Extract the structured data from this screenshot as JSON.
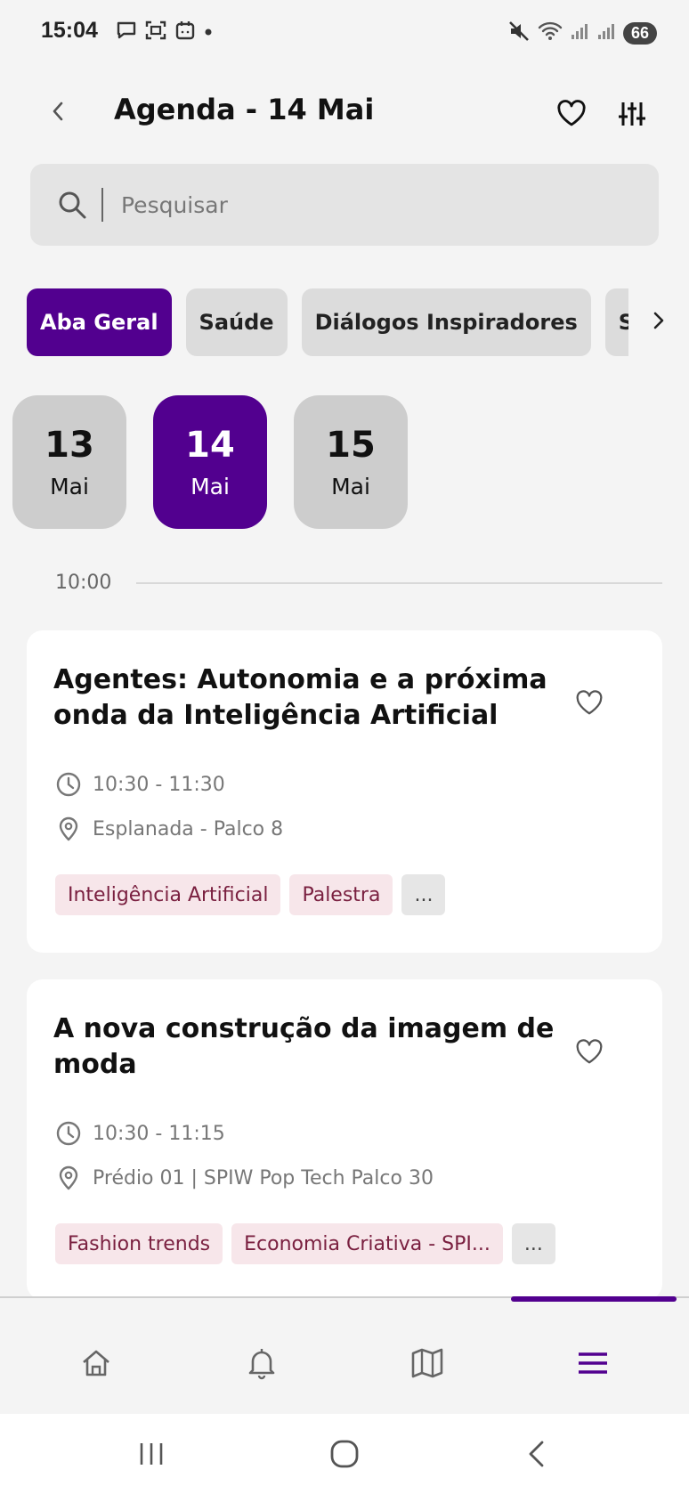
{
  "status_bar": {
    "time": "15:04",
    "battery": "66",
    "left_icons": [
      "message-icon",
      "screenshot-icon",
      "calendar-icon",
      "dot-icon"
    ],
    "right_icons": [
      "mute-icon",
      "wifi-icon",
      "signal-icon",
      "signal-icon"
    ]
  },
  "header": {
    "title": "Agenda - 14 Mai"
  },
  "search": {
    "placeholder": "Pesquisar"
  },
  "tabs": [
    {
      "label": "Aba Geral",
      "active": true
    },
    {
      "label": "Saúde",
      "active": false
    },
    {
      "label": "Diálogos Inspiradores",
      "active": false
    },
    {
      "label": "So",
      "active": false
    }
  ],
  "dates": [
    {
      "day": "13",
      "month": "Mai",
      "active": false
    },
    {
      "day": "14",
      "month": "Mai",
      "active": true
    },
    {
      "day": "15",
      "month": "Mai",
      "active": false
    }
  ],
  "timeslot": "10:00",
  "events": [
    {
      "title": "Agentes: Autonomia e a próxima onda da Inteligência Artificial",
      "time": "10:30 - 11:30",
      "location": "Esplanada - Palco 8",
      "tags": [
        "Inteligência Artificial",
        "Palestra",
        "..."
      ]
    },
    {
      "title": "A nova construção da imagem de moda",
      "time": "10:30 - 11:15",
      "location": "Prédio 01 | SPIW Pop Tech Palco 30",
      "tags": [
        "Fashion trends",
        "Economia Criativa - SPI...",
        "..."
      ]
    }
  ],
  "colors": {
    "accent": "#52008f",
    "tag_bg": "#f7e6ea",
    "tag_text": "#7a2040"
  },
  "bottom_nav": [
    "home-icon",
    "bell-icon",
    "map-icon",
    "menu-icon"
  ],
  "active_nav": "menu-icon"
}
